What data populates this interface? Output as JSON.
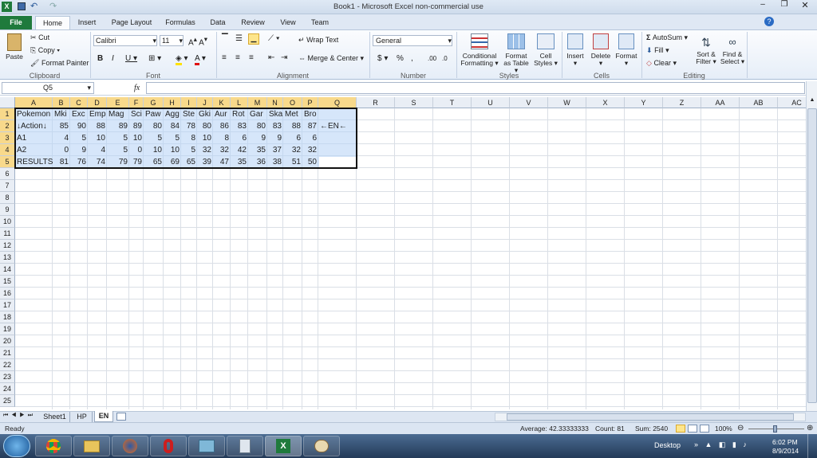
{
  "window": {
    "title": "Book1  -  Microsoft Excel non-commercial use"
  },
  "tabs": [
    "File",
    "Home",
    "Insert",
    "Page Layout",
    "Formulas",
    "Data",
    "Review",
    "View",
    "Team"
  ],
  "ribbon": {
    "paste": "Paste",
    "cut": "Cut",
    "copy": "Copy",
    "format_painter": "Format Painter",
    "clipboard": "Clipboard",
    "font_name": "Calibri",
    "font_size": "11",
    "font_group": "Font",
    "wrap_text": "Wrap Text",
    "merge_center": "Merge & Center",
    "alignment": "Alignment",
    "number_format": "General",
    "number": "Number",
    "cond1": "Conditional",
    "cond2": "Formatting",
    "fmt_table1": "Format",
    "fmt_table2": "as Table",
    "cell_styles1": "Cell",
    "cell_styles2": "Styles",
    "styles": "Styles",
    "insert": "Insert",
    "delete": "Delete",
    "format": "Format",
    "cells": "Cells",
    "autosum": "AutoSum",
    "fill": "Fill",
    "clear": "Clear",
    "sort1": "Sort &",
    "sort2": "Filter",
    "find1": "Find &",
    "find2": "Select",
    "editing": "Editing"
  },
  "formula_bar": {
    "name_box": "Q5",
    "fx": "fx",
    "value": ""
  },
  "columns": [
    "A",
    "B",
    "C",
    "D",
    "E",
    "F",
    "G",
    "H",
    "I",
    "J",
    "K",
    "L",
    "M",
    "N",
    "O",
    "P",
    "Q",
    "R",
    "S",
    "T",
    "U",
    "V",
    "W",
    "X",
    "Y",
    "Z",
    "AA",
    "AB",
    "AC"
  ],
  "rows": [
    "1",
    "2",
    "3",
    "4",
    "5",
    "6",
    "7",
    "8",
    "9",
    "10",
    "11",
    "12",
    "13",
    "14",
    "15",
    "16",
    "17",
    "18",
    "19",
    "20",
    "21",
    "22",
    "23",
    "24",
    "25"
  ],
  "cells": [
    [
      "Pokemon",
      "Mki",
      "Exc",
      "Emp",
      "Mag",
      "Sci",
      "Paw",
      "Agg",
      "Ste",
      "Gki",
      "Aur",
      "Rot",
      "Gar",
      "Ska",
      "Met",
      "Bro",
      ""
    ],
    [
      "↓Action↓",
      "85",
      "90",
      "88",
      "89",
      "89",
      "80",
      "84",
      "78",
      "80",
      "86",
      "83",
      "80",
      "83",
      "88",
      "87",
      "←EN←"
    ],
    [
      "A1",
      "4",
      "5",
      "10",
      "5",
      "10",
      "5",
      "5",
      "8",
      "10",
      "8",
      "6",
      "9",
      "9",
      "6",
      "6",
      ""
    ],
    [
      "A2",
      "0",
      "9",
      "4",
      "5",
      "0",
      "10",
      "10",
      "5",
      "32",
      "32",
      "42",
      "35",
      "37",
      "32",
      "32",
      ""
    ],
    [
      "RESULTS",
      "81",
      "76",
      "74",
      "79",
      "79",
      "65",
      "69",
      "65",
      "39",
      "47",
      "35",
      "36",
      "38",
      "51",
      "50",
      ""
    ]
  ],
  "sheets": [
    "Sheet1",
    "HP",
    "EN"
  ],
  "status": {
    "ready": "Ready",
    "average": "Average: 42.33333333",
    "count": "Count: 81",
    "sum": "Sum: 2540",
    "zoom": "100%"
  },
  "taskbar": {
    "desktop": "Desktop",
    "time": "6:02 PM",
    "date": "8/9/2014"
  }
}
